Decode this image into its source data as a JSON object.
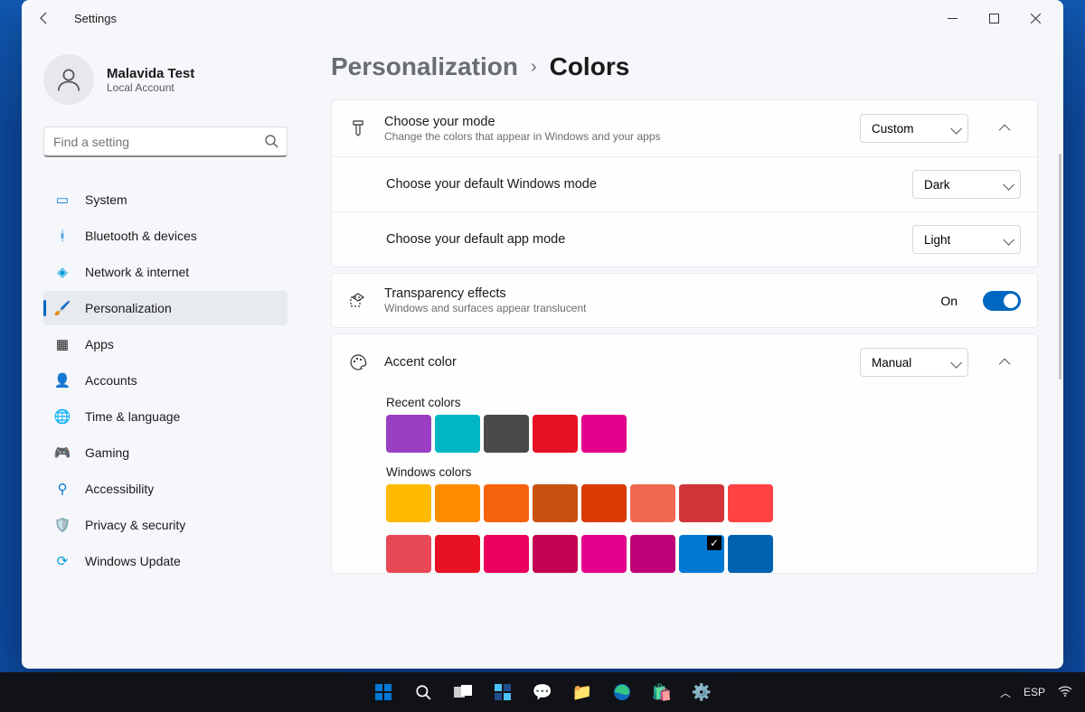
{
  "window": {
    "title": "Settings"
  },
  "user": {
    "name": "Malavida Test",
    "type": "Local Account"
  },
  "search": {
    "placeholder": "Find a setting"
  },
  "nav": {
    "items": [
      {
        "label": "System"
      },
      {
        "label": "Bluetooth & devices"
      },
      {
        "label": "Network & internet"
      },
      {
        "label": "Personalization"
      },
      {
        "label": "Apps"
      },
      {
        "label": "Accounts"
      },
      {
        "label": "Time & language"
      },
      {
        "label": "Gaming"
      },
      {
        "label": "Accessibility"
      },
      {
        "label": "Privacy & security"
      },
      {
        "label": "Windows Update"
      }
    ]
  },
  "breadcrumb": {
    "parent": "Personalization",
    "current": "Colors"
  },
  "mode": {
    "title": "Choose your mode",
    "sub": "Change the colors that appear in Windows and your apps",
    "value": "Custom",
    "windows_label": "Choose your default Windows mode",
    "windows_value": "Dark",
    "app_label": "Choose your default app mode",
    "app_value": "Light"
  },
  "transparency": {
    "title": "Transparency effects",
    "sub": "Windows and surfaces appear translucent",
    "state_label": "On"
  },
  "accent": {
    "title": "Accent color",
    "value": "Manual",
    "recent_label": "Recent colors",
    "recent": [
      "#9a3fc3",
      "#00b7c3",
      "#4a4a48",
      "#e81123",
      "#e3008c"
    ],
    "windows_label": "Windows colors",
    "windows_row1": [
      "#ffb900",
      "#ff8c00",
      "#f7630c",
      "#ca5010",
      "#da3b01",
      "#ef6950",
      "#d13438",
      "#ff4343"
    ],
    "windows_row2": [
      "#e74856",
      "#e81123",
      "#ea005e",
      "#c30052",
      "#e3008c",
      "#bf0077",
      "#0078d4",
      "#0063b1"
    ],
    "selected_index_row2": 6
  },
  "taskbar": {
    "lang": "ESP"
  }
}
